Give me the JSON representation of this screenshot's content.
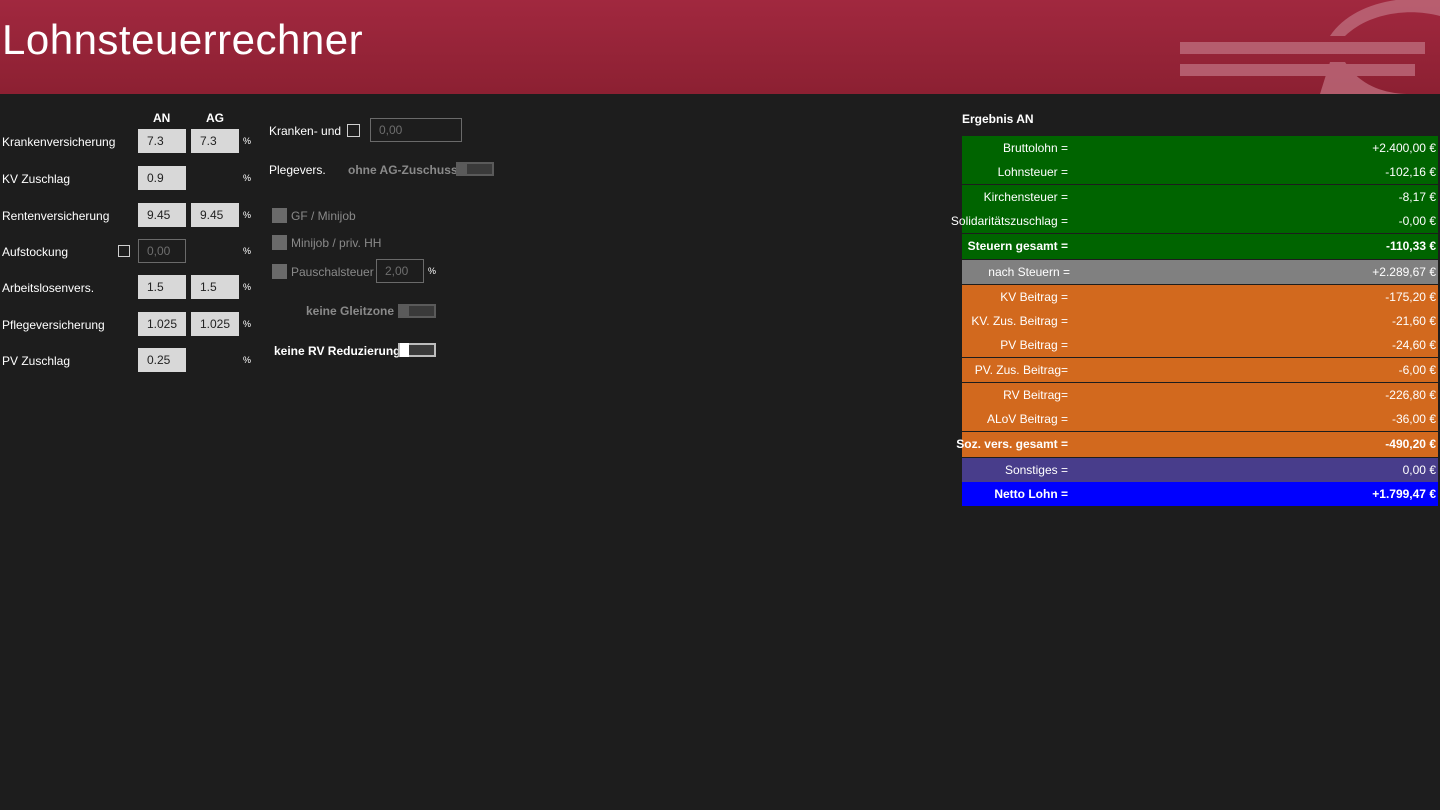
{
  "app": {
    "title": "Lohnsteuerrechner"
  },
  "colors": {
    "header": "#98243a",
    "background": "#1d1d1d",
    "green": "#006400",
    "gray": "#808080",
    "orange": "#d2691e",
    "purple": "#483d8b",
    "blue": "#0000ff"
  },
  "rates": {
    "col_an": "AN",
    "col_ag": "AG",
    "percent": "%",
    "kv": {
      "label": "Krankenversicherung",
      "an": "7.3",
      "ag": "7.3"
    },
    "kv_zuschlag": {
      "label": "KV Zuschlag",
      "an": "0.9"
    },
    "rv": {
      "label": "Rentenversicherung",
      "an": "9.45",
      "ag": "9.45"
    },
    "aufstockung": {
      "label": "Aufstockung",
      "value": "0,00"
    },
    "alv": {
      "label": "Arbeitslosenvers.",
      "an": "1.5",
      "ag": "1.5"
    },
    "pv": {
      "label": "Pflegeversicherung",
      "an": "1.025",
      "ag": "1.025"
    },
    "pv_zuschlag": {
      "label": "PV Zuschlag",
      "an": "0.25"
    }
  },
  "options": {
    "kranken_label": "Kranken- und",
    "kranken_value": "0,00",
    "pflege_label": "Plegevers.",
    "ohne_ag_label": "ohne AG-Zuschuss",
    "gf_minijob": "GF / Minijob",
    "minijob_hh": "Minijob / priv. HH",
    "pauschalsteuer": "Pauschalsteuer",
    "pauschal_value": "2,00",
    "gleitzone": "keine Gleitzone",
    "rv_reduzierung": "keine RV Reduzierung"
  },
  "result": {
    "title": "Ergebnis AN",
    "rows": [
      {
        "label": "Bruttolohn =",
        "value": "+2.400,00 €"
      },
      {
        "label": "Lohnsteuer =",
        "value": "-102,16 €"
      },
      {
        "label": "Kirchensteuer =",
        "value": "-8,17 €"
      },
      {
        "label": "Solidaritätszuschlag =",
        "value": "-0,00 €"
      },
      {
        "label": "Steuern gesamt =",
        "value": "-110,33 €"
      },
      {
        "label": "nach Steuern =",
        "value": "+2.289,67 €"
      },
      {
        "label": "KV Beitrag =",
        "value": "-175,20 €"
      },
      {
        "label": "KV. Zus. Beitrag =",
        "value": "-21,60 €"
      },
      {
        "label": "PV Beitrag =",
        "value": "-24,60 €"
      },
      {
        "label": "PV. Zus. Beitrag=",
        "value": "-6,00 €"
      },
      {
        "label": "RV Beitrag=",
        "value": "-226,80 €"
      },
      {
        "label": "ALoV Beitrag =",
        "value": "-36,00 €"
      },
      {
        "label": "Soz. vers. gesamt =",
        "value": "-490,20 €"
      },
      {
        "label": "Sonstiges =",
        "value": "0,00 €"
      },
      {
        "label": "Netto Lohn =",
        "value": "+1.799,47 €"
      }
    ]
  }
}
